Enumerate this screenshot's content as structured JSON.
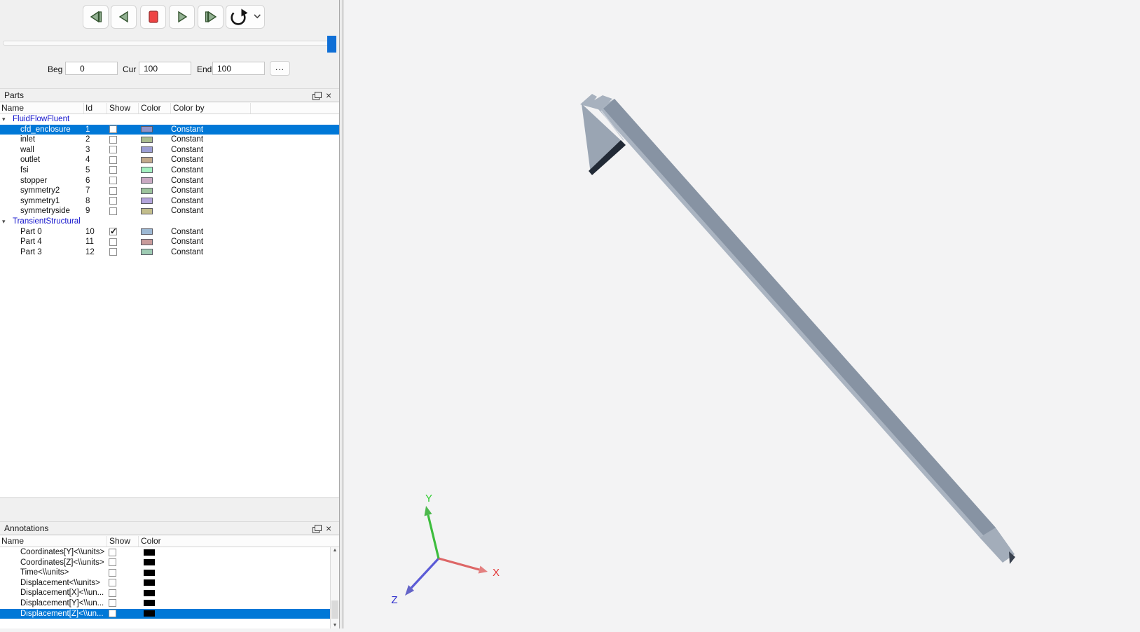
{
  "toolbar": {
    "buttons": [
      "step-backward",
      "play-backward",
      "stop",
      "play-forward",
      "step-forward",
      "loop"
    ]
  },
  "timeline": {
    "labels": {
      "beg": "Beg",
      "cur": "Cur",
      "end": "End"
    },
    "values": {
      "beg": "0",
      "cur": "100",
      "end": "100"
    },
    "more_button": "...",
    "slider_value": 100
  },
  "icons": {
    "close": "×",
    "check": "✓",
    "expander_open": "▾",
    "scroll_up": "▲",
    "scroll_down": "▼"
  },
  "selection_color": "#0078d7",
  "parts_panel": {
    "title": "Parts",
    "columns": [
      "Name",
      "Id",
      "Show",
      "Color",
      "Color by"
    ],
    "groups": [
      {
        "label": "FluidFlowFluent",
        "children": [
          {
            "name": "cfd_enclosure",
            "id": "1",
            "check": "",
            "color": "#9193c9",
            "color_by": "Constant",
            "selected": true
          },
          {
            "name": "inlet",
            "id": "2",
            "check": "",
            "color": "#a9bc8f",
            "color_by": "Constant",
            "selected": false
          },
          {
            "name": "wall",
            "id": "3",
            "check": "",
            "color": "#9b9dd3",
            "color_by": "Constant",
            "selected": false
          },
          {
            "name": "outlet",
            "id": "4",
            "check": "",
            "color": "#c2a98b",
            "color_by": "Constant",
            "selected": false
          },
          {
            "name": "fsi",
            "id": "5",
            "check": "",
            "color": "#a3f0c0",
            "color_by": "Constant",
            "selected": false
          },
          {
            "name": "stopper",
            "id": "6",
            "check": "",
            "color": "#c9a9c2",
            "color_by": "Constant",
            "selected": false
          },
          {
            "name": "symmetry2",
            "id": "7",
            "check": "",
            "color": "#9cc39c",
            "color_by": "Constant",
            "selected": false
          },
          {
            "name": "symmetry1",
            "id": "8",
            "check": "",
            "color": "#b2a3da",
            "color_by": "Constant",
            "selected": false
          },
          {
            "name": "symmetryside",
            "id": "9",
            "check": "",
            "color": "#c2bd8b",
            "color_by": "Constant",
            "selected": false
          }
        ]
      },
      {
        "label": "TransientStructural",
        "children": [
          {
            "name": "Part 0",
            "id": "10",
            "check": "✓",
            "color": "#9db8d3",
            "color_by": "Constant",
            "selected": false
          },
          {
            "name": "Part 4",
            "id": "11",
            "check": "",
            "color": "#c99b9b",
            "color_by": "Constant",
            "selected": false
          },
          {
            "name": "Part 3",
            "id": "12",
            "check": "",
            "color": "#9ecbb3",
            "color_by": "Constant",
            "selected": false
          }
        ]
      }
    ]
  },
  "annotations_panel": {
    "title": "Annotations",
    "columns": [
      "Name",
      "Show",
      "Color"
    ],
    "rows": [
      {
        "name": "Coordinates[Y]<\\\\units>",
        "check": "",
        "color": "#000000",
        "selected": false
      },
      {
        "name": "Coordinates[Z]<\\\\units>",
        "check": "",
        "color": "#000000",
        "selected": false
      },
      {
        "name": "Time<\\\\units>",
        "check": "",
        "color": "#000000",
        "selected": false
      },
      {
        "name": "Displacement<\\\\units>",
        "check": "",
        "color": "#000000",
        "selected": false
      },
      {
        "name": "Displacement[X]<\\\\un...",
        "check": "",
        "color": "#000000",
        "selected": false
      },
      {
        "name": "Displacement[Y]<\\\\un...",
        "check": "",
        "color": "#000000",
        "selected": false
      },
      {
        "name": "Displacement[Z]<\\\\un...",
        "check": "",
        "color": "#000000",
        "selected": true
      }
    ]
  },
  "viewport": {
    "scene": "deformed-beam-3d",
    "background": "#f3f3f4",
    "beam_colors": {
      "main": "#8793a3",
      "edge_light": "#aab4c1",
      "end_light": "#a3adba",
      "cap": "#a7b1be",
      "fin": "#9aa5b3",
      "fin_shadow": "#222a36",
      "tip_dark": "#3a424f"
    },
    "axes": [
      {
        "label": "X",
        "color": "#e23333",
        "shaft": "#dd6666",
        "head": "#e38080"
      },
      {
        "label": "Y",
        "color": "#2ecc2e",
        "shaft": "#3dbd3d",
        "head": "#4cb84c"
      },
      {
        "label": "Z",
        "color": "#2c2ccc",
        "shaft": "#5b5bd6",
        "head": "#6464c8"
      }
    ]
  }
}
